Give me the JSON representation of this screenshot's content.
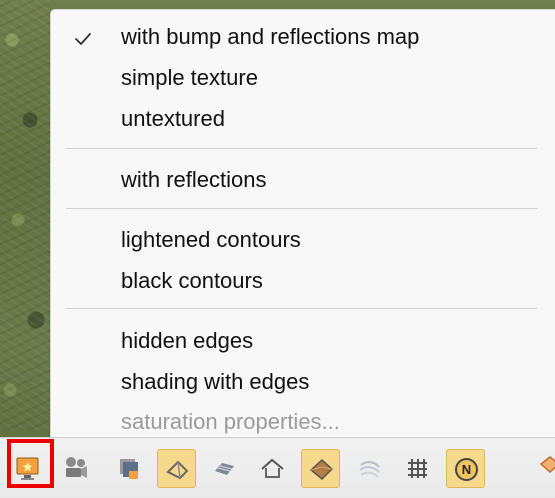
{
  "menu": {
    "items": [
      {
        "label": "with bump and reflections map",
        "checked": true,
        "enabled": true
      },
      {
        "label": "simple texture",
        "checked": false,
        "enabled": true
      },
      {
        "label": "untextured",
        "checked": false,
        "enabled": true
      },
      {
        "label": "with reflections",
        "checked": false,
        "enabled": true
      },
      {
        "label": "lightened contours",
        "checked": false,
        "enabled": true
      },
      {
        "label": "black contours",
        "checked": false,
        "enabled": true
      },
      {
        "label": "hidden edges",
        "checked": false,
        "enabled": true
      },
      {
        "label": "shading with edges",
        "checked": false,
        "enabled": true
      },
      {
        "label": "saturation properties...",
        "checked": false,
        "enabled": false
      }
    ]
  },
  "toolbar": {
    "icons": [
      "display-mode-icon",
      "camera-icon",
      "layers-icon",
      "wireframe-icon",
      "bundle-icon",
      "house-icon",
      "shaded-surface-icon",
      "contour-lines-icon",
      "grid-icon",
      "north-icon",
      "partial-orange-icon"
    ],
    "active_indices": [
      3,
      6,
      9
    ],
    "highlight_index": 0,
    "highlight_color": "#ef0000",
    "active_color": "#f7d98b",
    "north_label": "N"
  }
}
